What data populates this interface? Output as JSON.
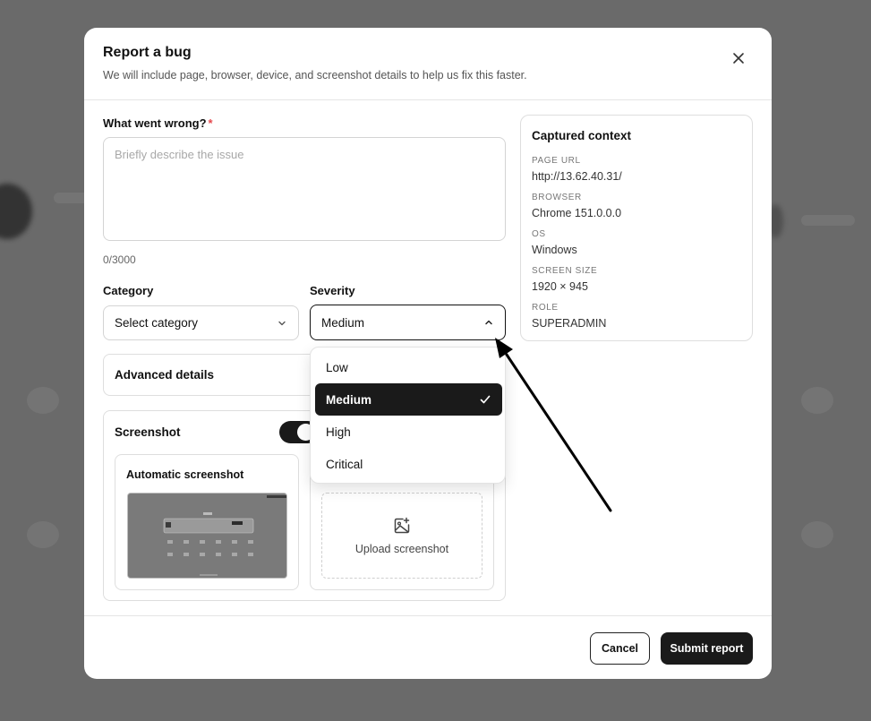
{
  "modal": {
    "title": "Report a bug",
    "subtitle": "We will include page, browser, device, and screenshot details to help us fix this faster."
  },
  "form": {
    "description": {
      "label": "What went wrong?",
      "required_mark": "*",
      "placeholder": "Briefly describe the issue",
      "value": "",
      "counter": "0/3000"
    },
    "category": {
      "label": "Category",
      "selected": "Select category"
    },
    "severity": {
      "label": "Severity",
      "selected": "Medium",
      "options": [
        "Low",
        "Medium",
        "High",
        "Critical"
      ]
    },
    "advanced": {
      "label": "Advanced details"
    },
    "screenshot": {
      "label": "Screenshot",
      "enabled": true,
      "automatic_label": "Automatic screenshot",
      "upload_label": "Upload screenshot"
    }
  },
  "context": {
    "title": "Captured context",
    "items": [
      {
        "key": "PAGE URL",
        "value": "http://13.62.40.31/"
      },
      {
        "key": "BROWSER",
        "value": "Chrome 151.0.0.0"
      },
      {
        "key": "OS",
        "value": "Windows"
      },
      {
        "key": "SCREEN SIZE",
        "value": "1920 × 945"
      },
      {
        "key": "ROLE",
        "value": "SUPERADMIN"
      }
    ]
  },
  "footer": {
    "cancel_label": "Cancel",
    "submit_label": "Submit report"
  },
  "colors": {
    "accent": "#1a1a1a",
    "required": "#e5484d",
    "backdrop": "#6a6a6a"
  },
  "icons": {
    "close": "x-icon",
    "chevron": "chevron-down-icon",
    "chevron_open": "chevron-up-icon",
    "check": "check-icon",
    "upload": "image-plus-icon"
  }
}
